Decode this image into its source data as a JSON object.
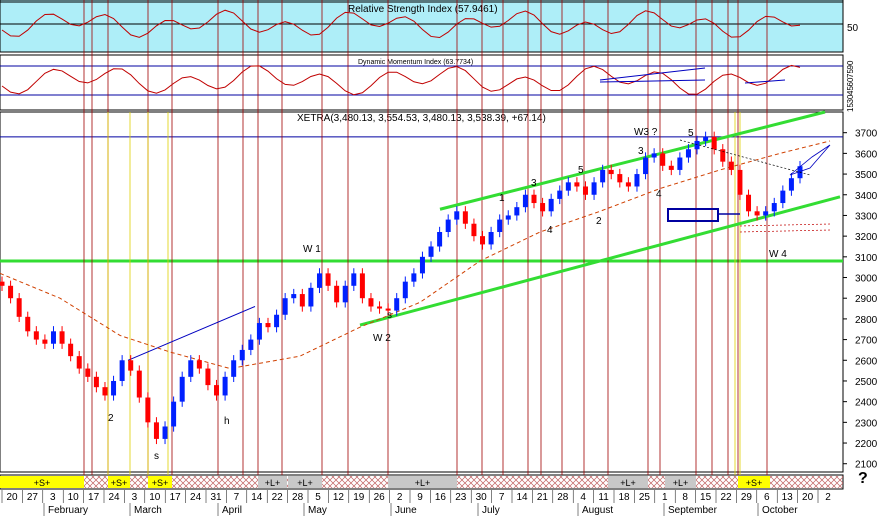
{
  "chart_data": [
    {
      "type": "line",
      "title": "Relative Strength Index (57.9461)",
      "right_axis_labels": [
        "50"
      ],
      "background": "#aeeef8"
    },
    {
      "type": "line",
      "title": "Dynamic Momentum Index (63.7734)",
      "right_axis_labels": [
        "15",
        "30",
        "45",
        "60",
        "75",
        "90"
      ]
    },
    {
      "type": "candlestick",
      "title": "XETRA(3,480.13, 3,554.53, 3,480.13, 3,538.39, +67.14)",
      "ylim": [
        2060,
        3800
      ],
      "yticks": [
        2100,
        2200,
        2300,
        2400,
        2500,
        2600,
        2700,
        2800,
        2900,
        3000,
        3100,
        3200,
        3300,
        3400,
        3500,
        3600,
        3700
      ],
      "xticks_days": [
        "20",
        "27",
        "3",
        "10",
        "17",
        "24",
        "3",
        "10",
        "17",
        "24",
        "31",
        "7",
        "14",
        "22",
        "28",
        "5",
        "12",
        "19",
        "26",
        "2",
        "9",
        "16",
        "23",
        "30",
        "7",
        "14",
        "21",
        "28",
        "4",
        "11",
        "18",
        "25",
        "1",
        "8",
        "15",
        "22",
        "29",
        "6",
        "13",
        "20",
        "2"
      ],
      "months": [
        "February",
        "March",
        "April",
        "May",
        "June",
        "July",
        "August",
        "September",
        "October"
      ],
      "annotations": [
        {
          "text": "W 1",
          "color": "#b000b0"
        },
        {
          "text": "W 2",
          "color": "#b000b0"
        },
        {
          "text": "W3 ?",
          "color": "#b000b0"
        },
        {
          "text": "W 4",
          "color": "#b000b0"
        },
        {
          "text": "1"
        },
        {
          "text": "2"
        },
        {
          "text": "3"
        },
        {
          "text": "4"
        },
        {
          "text": "5"
        },
        {
          "text": "3"
        },
        {
          "text": "4"
        },
        {
          "text": "5"
        },
        {
          "text": "2"
        },
        {
          "text": "s",
          "color": "#0000a0"
        },
        {
          "text": "h",
          "color": "#0000a0"
        },
        {
          "text": "s",
          "color": "#0000a0"
        }
      ],
      "signals": [
        "+S+",
        "+S+",
        "+S+",
        "+L+",
        "+L+",
        "+L+",
        "+L+",
        "+L+",
        "+S+"
      ],
      "close_series": [
        2960,
        2900,
        2810,
        2740,
        2700,
        2680,
        2740,
        2680,
        2620,
        2560,
        2520,
        2470,
        2430,
        2500,
        2600,
        2550,
        2420,
        2300,
        2220,
        2280,
        2400,
        2520,
        2600,
        2560,
        2480,
        2430,
        2520,
        2600,
        2650,
        2700,
        2780,
        2760,
        2820,
        2900,
        2920,
        2860,
        2950,
        3020,
        2960,
        2880,
        2960,
        3020,
        2900,
        2860,
        2850,
        2840,
        2900,
        2980,
        3020,
        3100,
        3150,
        3220,
        3280,
        3320,
        3260,
        3200,
        3160,
        3220,
        3280,
        3300,
        3340,
        3400,
        3360,
        3320,
        3380,
        3420,
        3460,
        3440,
        3400,
        3460,
        3520,
        3500,
        3460,
        3440,
        3500,
        3580,
        3600,
        3540,
        3520,
        3580,
        3620,
        3660,
        3680,
        3620,
        3560,
        3520,
        3400,
        3320,
        3300,
        3320,
        3360,
        3420,
        3480,
        3538
      ]
    }
  ],
  "help_mark": "?",
  "colors": {
    "green_channel": "#33dd33",
    "vertical_lines": "#a00000",
    "ma_curve": "#d04000",
    "up_candle": "#0020ff",
    "down_candle": "#ff0000"
  }
}
